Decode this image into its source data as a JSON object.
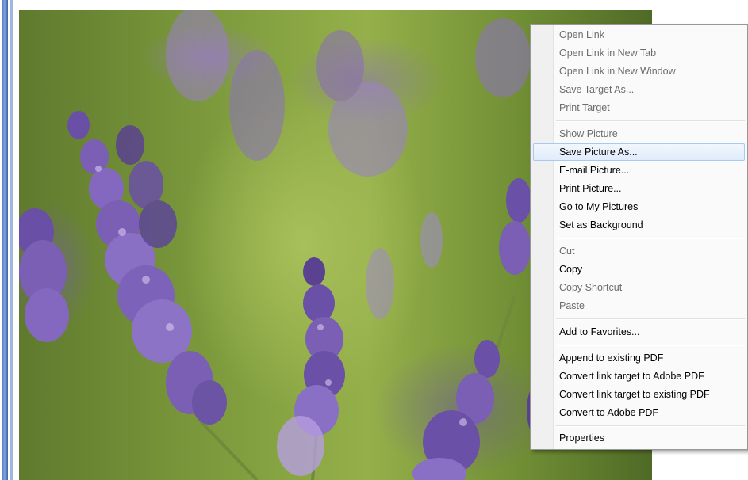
{
  "image": {
    "alt": "",
    "colors": {
      "lavender": "#7a5fb4",
      "lavender_dark": "#4b3580",
      "stem": "#6f8d34",
      "highlight": "#a8c8ee"
    }
  },
  "context_menu": {
    "items": [
      {
        "label": "Open Link",
        "disabled": true
      },
      {
        "label": "Open Link in New Tab",
        "disabled": true
      },
      {
        "label": "Open Link in New Window",
        "disabled": true
      },
      {
        "label": "Save Target As...",
        "disabled": true
      },
      {
        "label": "Print Target",
        "disabled": true
      },
      {
        "label": "Show Picture",
        "disabled": true
      },
      {
        "label": "Save Picture As...",
        "disabled": false,
        "highlighted": true
      },
      {
        "label": "E-mail Picture...",
        "disabled": false
      },
      {
        "label": "Print Picture...",
        "disabled": false
      },
      {
        "label": "Go to My Pictures",
        "disabled": false
      },
      {
        "label": "Set as Background",
        "disabled": false
      },
      {
        "label": "Cut",
        "disabled": true
      },
      {
        "label": "Copy",
        "disabled": false
      },
      {
        "label": "Copy Shortcut",
        "disabled": true
      },
      {
        "label": "Paste",
        "disabled": true
      },
      {
        "label": "Add to Favorites...",
        "disabled": false
      },
      {
        "label": "Append to existing PDF",
        "disabled": false
      },
      {
        "label": "Convert link target to Adobe PDF",
        "disabled": false
      },
      {
        "label": "Convert link target to existing PDF",
        "disabled": false
      },
      {
        "label": "Convert to Adobe PDF",
        "disabled": false
      },
      {
        "label": "Properties",
        "disabled": false
      }
    ]
  }
}
